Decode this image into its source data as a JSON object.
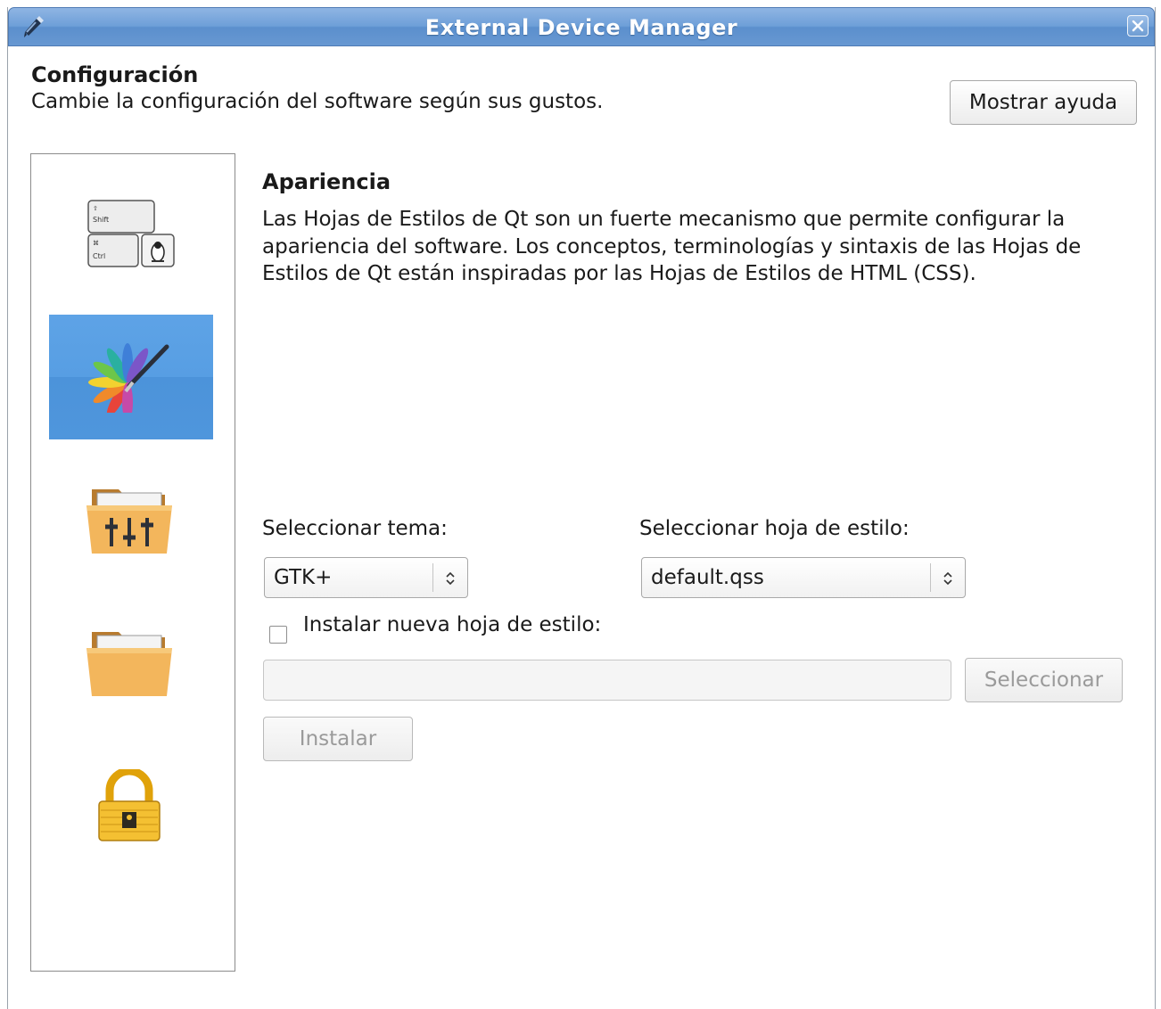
{
  "window": {
    "title": "External Device Manager",
    "title_bar_color": "#6e9fd8",
    "app_icon": "pen-icon",
    "close_icon": "close-icon"
  },
  "header": {
    "title": "Configuración",
    "subtitle": "Cambie la configuración del software según sus gustos.",
    "help_button": "Mostrar ayuda"
  },
  "sidebar": {
    "selected_index": 1,
    "selection_color": "#579ee3",
    "items": [
      {
        "icon": "keyboard-shortcuts-icon",
        "key_labels": [
          "Shift",
          "Ctrl"
        ]
      },
      {
        "icon": "appearance-palette-icon"
      },
      {
        "icon": "folder-settings-icon"
      },
      {
        "icon": "folder-icon"
      },
      {
        "icon": "lock-icon"
      }
    ]
  },
  "section": {
    "title": "Apariencia",
    "description": "Las Hojas de Estilos de Qt son un fuerte mecanismo que permite configurar la apariencia del software. Los conceptos, terminologías y sintaxis de las Hojas de Estilos de Qt están inspiradas por las Hojas de Estilos de HTML (CSS)."
  },
  "form": {
    "theme_label": "Seleccionar tema:",
    "theme_value": "GTK+",
    "stylesheet_label": "Seleccionar hoja de estilo:",
    "stylesheet_value": "default.qss",
    "install_checkbox_label": "Instalar nueva hoja de estilo:",
    "install_checked": false,
    "path_value": "",
    "select_button": "Seleccionar",
    "install_button": "Instalar"
  }
}
